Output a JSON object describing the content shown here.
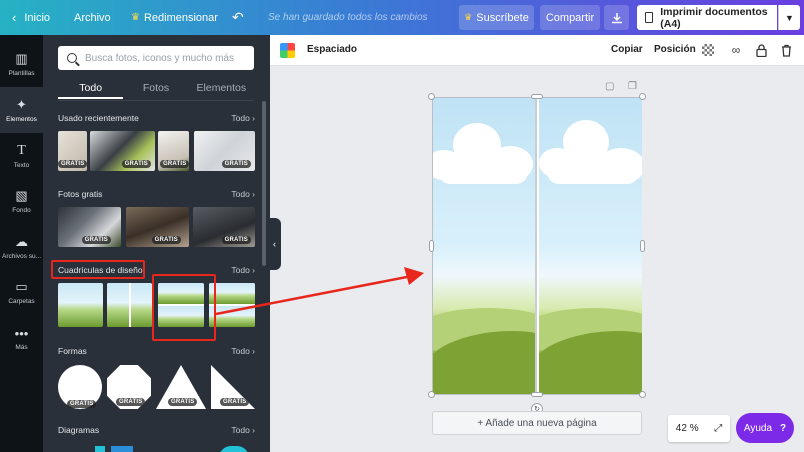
{
  "topbar": {
    "home": "Inicio",
    "file": "Archivo",
    "resize": "Redimensionar",
    "saved_status": "Se han guardado todos los cambios",
    "subscribe": "Suscríbete",
    "share": "Compartir",
    "print": "Imprimir documentos (A4)"
  },
  "rail": {
    "items": [
      {
        "label": "Plantillas",
        "icon": "templates-icon"
      },
      {
        "label": "Elementos",
        "icon": "elements-icon"
      },
      {
        "label": "Texto",
        "icon": "text-icon"
      },
      {
        "label": "Fondo",
        "icon": "background-icon"
      },
      {
        "label": "Archivos su...",
        "icon": "upload-icon"
      },
      {
        "label": "Carpetas",
        "icon": "folder-icon"
      },
      {
        "label": "Más",
        "icon": "more-icon"
      }
    ]
  },
  "panel": {
    "search_placeholder": "Busca fotos, iconos y mucho más",
    "tabs": [
      "Todo",
      "Fotos",
      "Elementos"
    ],
    "see_all": "Todo",
    "free_badge": "GRATIS",
    "sections": {
      "recent": "Usado recientemente",
      "free_photos": "Fotos gratis",
      "grids": "Cuadrículas de diseño",
      "shapes": "Formas",
      "charts": "Diagramas"
    }
  },
  "editor": {
    "spacing": "Espaciado",
    "copy": "Copiar",
    "position": "Posición",
    "add_page": "+ Añade una nueva página",
    "zoom": "42 %",
    "help": "Ayuda",
    "help_q": "?"
  },
  "colors": {
    "accent": "#7d2ae8",
    "highlight": "#e8261c",
    "panel_bg": "#2a3039",
    "rail_bg": "#0e1318"
  }
}
